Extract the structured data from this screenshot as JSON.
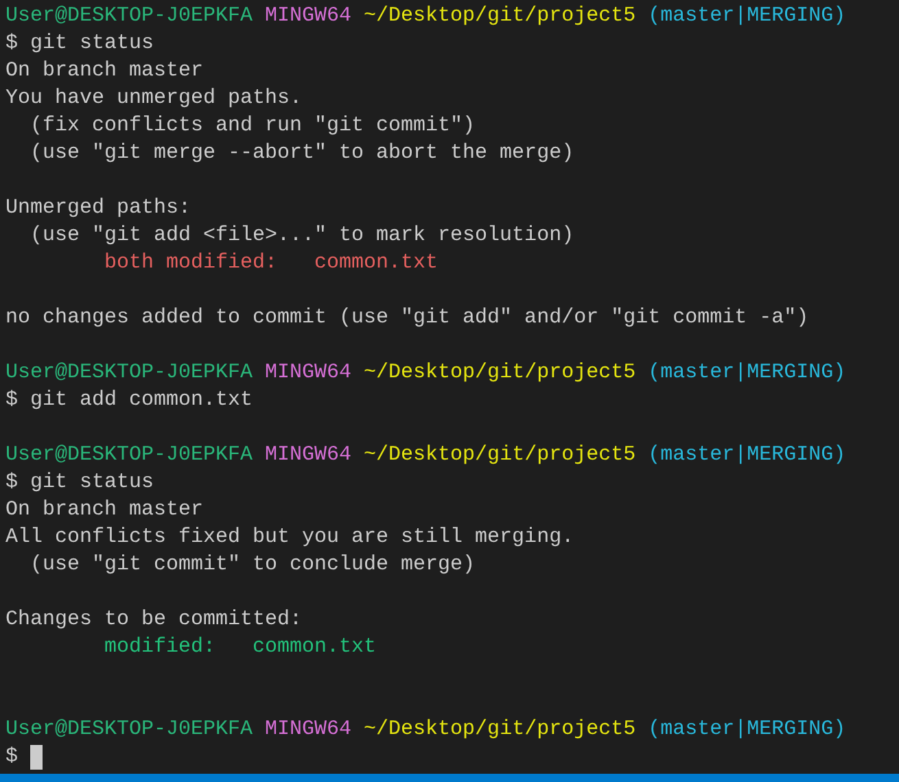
{
  "terminal": {
    "lines": [
      {
        "kind": "prompt",
        "user": "User@DESKTOP-J0EPKFA",
        "system": "MINGW64",
        "path": "~/Desktop/git/project5",
        "branch": "(master|MERGING)"
      },
      {
        "kind": "command",
        "symbol": "$",
        "text": "git status"
      },
      {
        "kind": "output",
        "text": "On branch master"
      },
      {
        "kind": "output",
        "text": "You have unmerged paths."
      },
      {
        "kind": "output",
        "text": "  (fix conflicts and run \"git commit\")"
      },
      {
        "kind": "output",
        "text": "  (use \"git merge --abort\" to abort the merge)"
      },
      {
        "kind": "blank"
      },
      {
        "kind": "output",
        "text": "Unmerged paths:"
      },
      {
        "kind": "output",
        "text": "  (use \"git add <file>...\" to mark resolution)"
      },
      {
        "kind": "status",
        "text": "both modified:   common.txt",
        "color": "#e5605f"
      },
      {
        "kind": "blank"
      },
      {
        "kind": "output",
        "text": "no changes added to commit (use \"git add\" and/or \"git commit -a\")"
      },
      {
        "kind": "blank"
      },
      {
        "kind": "prompt",
        "user": "User@DESKTOP-J0EPKFA",
        "system": "MINGW64",
        "path": "~/Desktop/git/project5",
        "branch": "(master|MERGING)"
      },
      {
        "kind": "command",
        "symbol": "$",
        "text": "git add common.txt"
      },
      {
        "kind": "blank"
      },
      {
        "kind": "prompt",
        "user": "User@DESKTOP-J0EPKFA",
        "system": "MINGW64",
        "path": "~/Desktop/git/project5",
        "branch": "(master|MERGING)"
      },
      {
        "kind": "command",
        "symbol": "$",
        "text": "git status"
      },
      {
        "kind": "output",
        "text": "On branch master"
      },
      {
        "kind": "output",
        "text": "All conflicts fixed but you are still merging."
      },
      {
        "kind": "output",
        "text": "  (use \"git commit\" to conclude merge)"
      },
      {
        "kind": "blank"
      },
      {
        "kind": "output",
        "text": "Changes to be committed:"
      },
      {
        "kind": "status",
        "text": "modified:   common.txt",
        "color": "#23c17b"
      },
      {
        "kind": "blank"
      },
      {
        "kind": "blank"
      },
      {
        "kind": "prompt",
        "user": "User@DESKTOP-J0EPKFA",
        "system": "MINGW64",
        "path": "~/Desktop/git/project5",
        "branch": "(master|MERGING)"
      },
      {
        "kind": "input",
        "symbol": "$",
        "cursor": true
      }
    ]
  }
}
